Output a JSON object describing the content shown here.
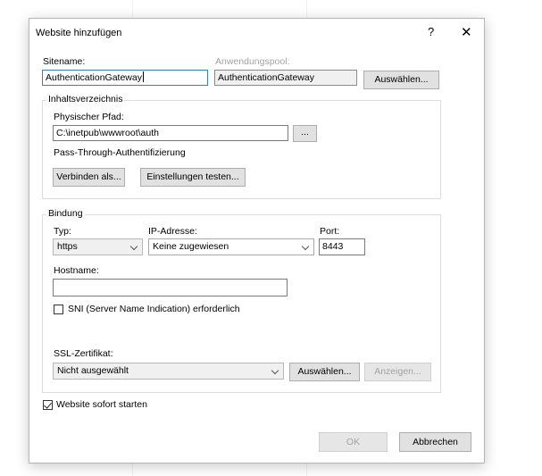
{
  "dialog": {
    "title": "Website hinzufügen",
    "help_label": "?",
    "close_label": "✕"
  },
  "site": {
    "name_label": "Sitename:",
    "name_value": "AuthenticationGateway",
    "pool_label": "Anwendungspool:",
    "pool_value": "AuthenticationGateway",
    "pool_select_button": "Auswählen..."
  },
  "content_dir": {
    "legend": "Inhaltsverzeichnis",
    "path_label": "Physischer Pfad:",
    "path_value": "C:\\inetpub\\wwwroot\\auth",
    "browse_button": "...",
    "passthrough_label": "Pass-Through-Authentifizierung",
    "connect_as_button": "Verbinden als...",
    "test_settings_button": "Einstellungen testen..."
  },
  "binding": {
    "legend": "Bindung",
    "type_label": "Typ:",
    "type_value": "https",
    "ip_label": "IP-Adresse:",
    "ip_value": "Keine zugewiesen",
    "port_label": "Port:",
    "port_value": "8443",
    "hostname_label": "Hostname:",
    "hostname_value": "",
    "sni_label": "SNI (Server Name Indication) erforderlich",
    "sni_checked": false,
    "ssl_label": "SSL-Zertifikat:",
    "ssl_value": "Nicht ausgewählt",
    "ssl_select_button": "Auswählen...",
    "ssl_view_button": "Anzeigen..."
  },
  "start_immediately": {
    "label": "Website sofort starten",
    "checked": true
  },
  "footer": {
    "ok_button": "OK",
    "cancel_button": "Abbrechen"
  }
}
